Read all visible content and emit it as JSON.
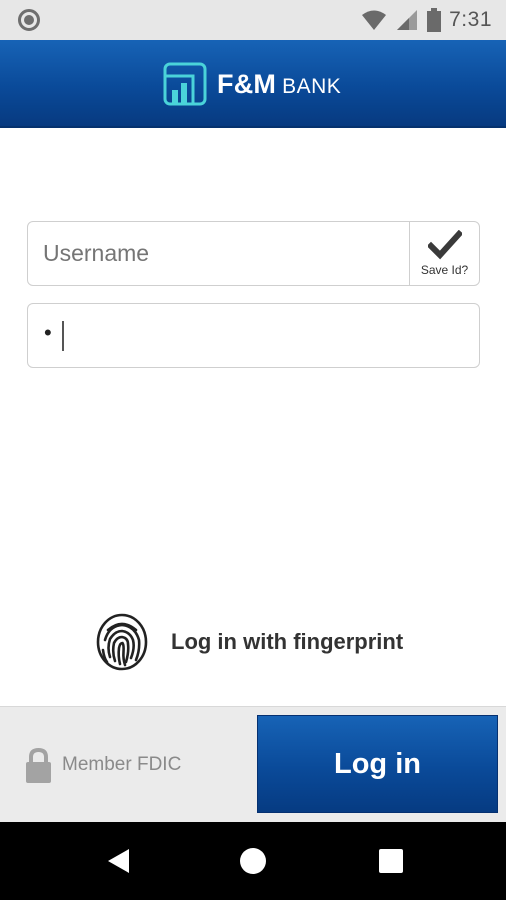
{
  "status_bar": {
    "time": "7:31",
    "icons": [
      "notification-circle-icon",
      "wifi-icon",
      "signal-icon",
      "battery-icon"
    ]
  },
  "header": {
    "brand_main": "F&M",
    "brand_sub": "BANK",
    "color": "#0a4a99"
  },
  "login_form": {
    "username_placeholder": "Username",
    "username_value": "",
    "save_id_label": "Save Id?",
    "save_id_checked": true,
    "password_value": "•"
  },
  "fingerprint": {
    "label": "Log in with fingerprint"
  },
  "footer": {
    "fdic_label": "Member FDIC",
    "login_label": "Log in"
  },
  "navigation": {
    "buttons": [
      "back-icon",
      "home-icon",
      "recents-icon"
    ]
  }
}
